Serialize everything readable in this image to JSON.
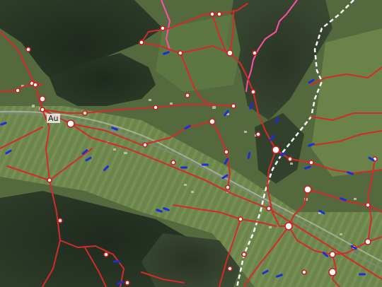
{
  "map": {
    "view": "satellite",
    "place_label": "Au"
  },
  "layers": {
    "trails": {
      "color": "#d42a2a"
    },
    "trail_nodes": {
      "fill": "#ffffff",
      "stroke": "#c81e1e"
    },
    "boundary": {
      "color": "#ffffff",
      "style": "dashed"
    },
    "pink_trail": {
      "color": "#ff4fa8"
    },
    "markers": {
      "color": "#1b2fd6",
      "icon": "blue-dash-marker"
    }
  }
}
